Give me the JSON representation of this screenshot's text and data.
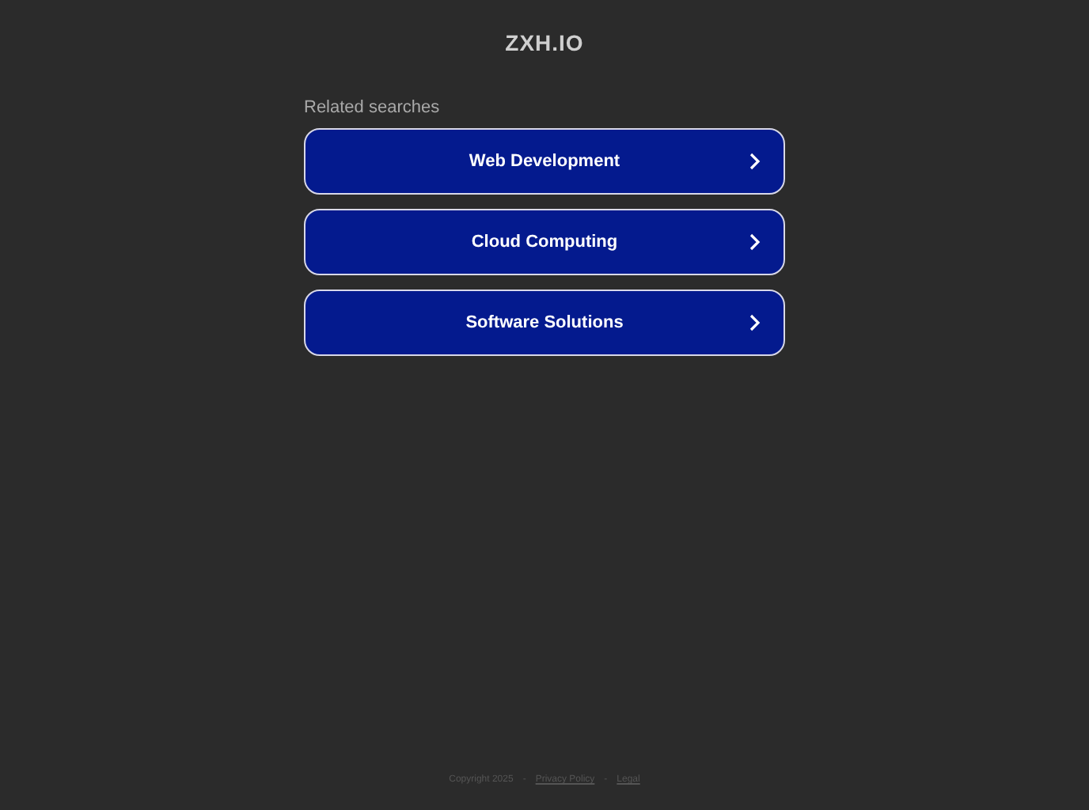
{
  "header": {
    "domain": "ZXH.IO"
  },
  "related": {
    "heading": "Related searches",
    "items": [
      {
        "label": "Web Development"
      },
      {
        "label": "Cloud Computing"
      },
      {
        "label": "Software Solutions"
      }
    ]
  },
  "footer": {
    "copyright": "Copyright 2025",
    "separators": [
      "-",
      "-"
    ],
    "links": [
      "Privacy Policy",
      "Legal"
    ]
  }
}
